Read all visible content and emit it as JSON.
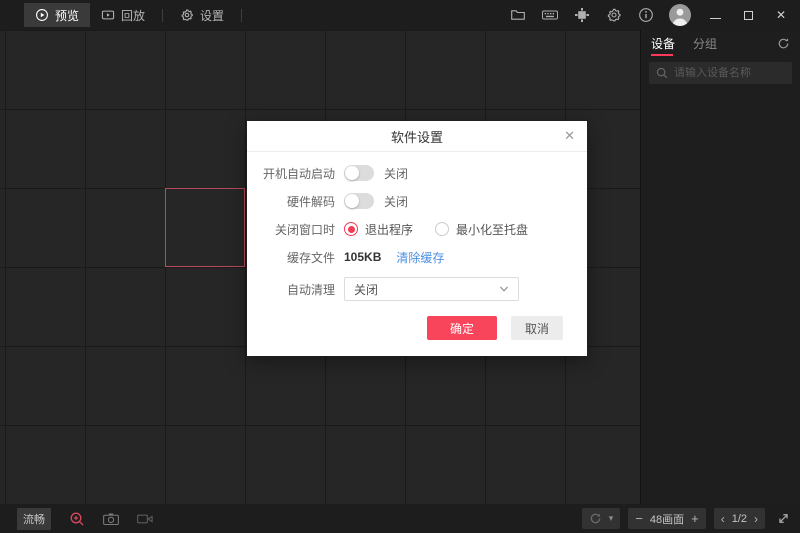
{
  "top_nav": {
    "tabs": [
      {
        "label": "预览",
        "active": true
      },
      {
        "label": "回放",
        "active": false
      },
      {
        "label": "设置",
        "active": false
      }
    ]
  },
  "titlebar": {
    "icons": [
      "folder",
      "keyboard",
      "plugin",
      "gear",
      "info",
      "avatar"
    ],
    "window_controls": {
      "minimize": "minimize",
      "maximize": "maximize",
      "close": "✕"
    }
  },
  "sidebar": {
    "tabs": [
      {
        "label": "设备",
        "active": true
      },
      {
        "label": "分组",
        "active": false
      }
    ],
    "search": {
      "placeholder": "请输入设备名称"
    }
  },
  "dialog": {
    "title": "软件设置",
    "close_glyph": "✕",
    "rows": {
      "autostart": {
        "label": "开机自动启动",
        "state": "关闭",
        "on": false
      },
      "hwdecode": {
        "label": "硬件解码",
        "state": "关闭",
        "on": false
      },
      "on_close": {
        "label": "关闭窗口时",
        "options": [
          {
            "label": "退出程序",
            "selected": true
          },
          {
            "label": "最小化至托盘",
            "selected": false
          }
        ]
      },
      "cache": {
        "label": "缓存文件",
        "value": "105KB",
        "action": "清除缓存"
      },
      "auto_clean": {
        "label": "自动清理",
        "value": "关闭"
      }
    },
    "ok_label": "确定",
    "cancel_label": "取消"
  },
  "bottom_bar": {
    "quality": "流畅",
    "screens_label": "48画面",
    "page": "1/2",
    "minus": "−",
    "plus": "+",
    "prev": "‹",
    "next": "›",
    "caret": "▾"
  },
  "colors": {
    "accent": "#f9455c",
    "tab_underline": "#fb3a5d",
    "link": "#4a90e2",
    "selected_cell_border": "#b74a5c"
  }
}
